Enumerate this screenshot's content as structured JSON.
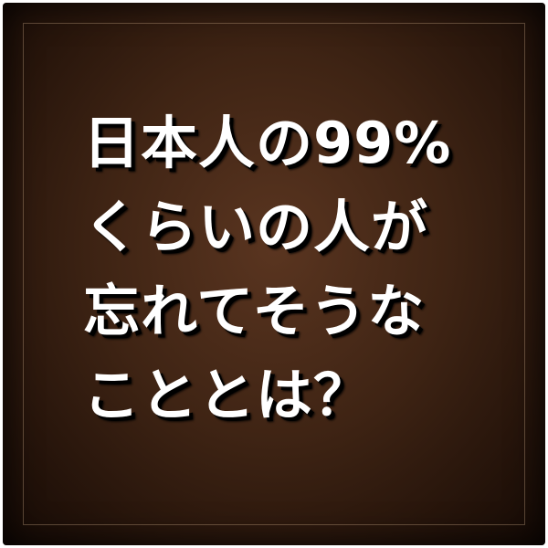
{
  "headline": {
    "lines": [
      "日本人の99%",
      "くらいの人が",
      "忘れてそうな",
      "こととは？"
    ]
  },
  "colors": {
    "background": "#3f2414",
    "text": "#ffffff",
    "shadow": "#000000"
  }
}
